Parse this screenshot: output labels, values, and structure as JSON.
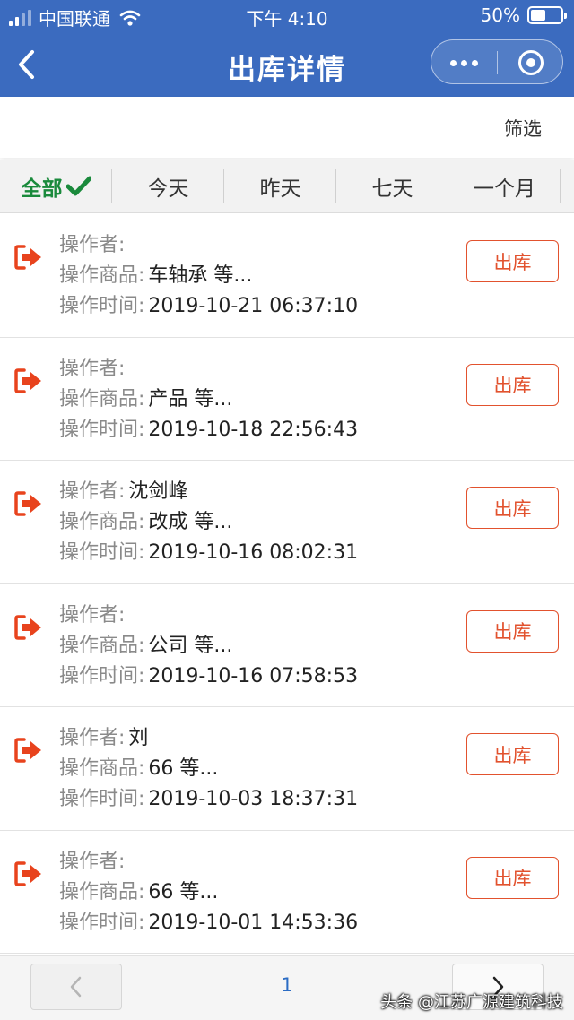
{
  "status_bar": {
    "carrier": "中国联通",
    "time": "下午 4:10",
    "battery": "50%",
    "battery_level": 0.5
  },
  "nav": {
    "title": "出库详情",
    "icons": [
      "back-arrow-icon",
      "more-dots-icon",
      "close-target-icon"
    ]
  },
  "filter": {
    "label": "筛选"
  },
  "tabs": [
    {
      "label": "全部",
      "active": true
    },
    {
      "label": "今天"
    },
    {
      "label": "昨天"
    },
    {
      "label": "七天"
    },
    {
      "label": "一个月"
    }
  ],
  "labels": {
    "operator": "操作者:",
    "goods": "操作商品:",
    "time": "操作时间:"
  },
  "records": [
    {
      "operator": "",
      "goods": "车轴承 等...",
      "time": "2019-10-21 06:37:10",
      "action": "出库"
    },
    {
      "operator": "",
      "goods": "产品 等...",
      "time": "2019-10-18 22:56:43",
      "action": "出库"
    },
    {
      "operator": "沈剑峰",
      "goods": "改成 等...",
      "time": "2019-10-16 08:02:31",
      "action": "出库"
    },
    {
      "operator": "",
      "goods": "公司 等...",
      "time": "2019-10-16 07:58:53",
      "action": "出库"
    },
    {
      "operator": "刘",
      "goods": "66 等...",
      "time": "2019-10-03 18:37:31",
      "action": "出库"
    },
    {
      "operator": "",
      "goods": "66 等...",
      "time": "2019-10-01 14:53:36",
      "action": "出库"
    }
  ],
  "pager": {
    "current_page": "1"
  },
  "watermark": "头条 @江苏广源建筑科技",
  "colors": {
    "header": "#3b6bbf",
    "accent_orange": "#e2522e",
    "active_green": "#1a8a3c",
    "page_link": "#2b6cc4"
  }
}
